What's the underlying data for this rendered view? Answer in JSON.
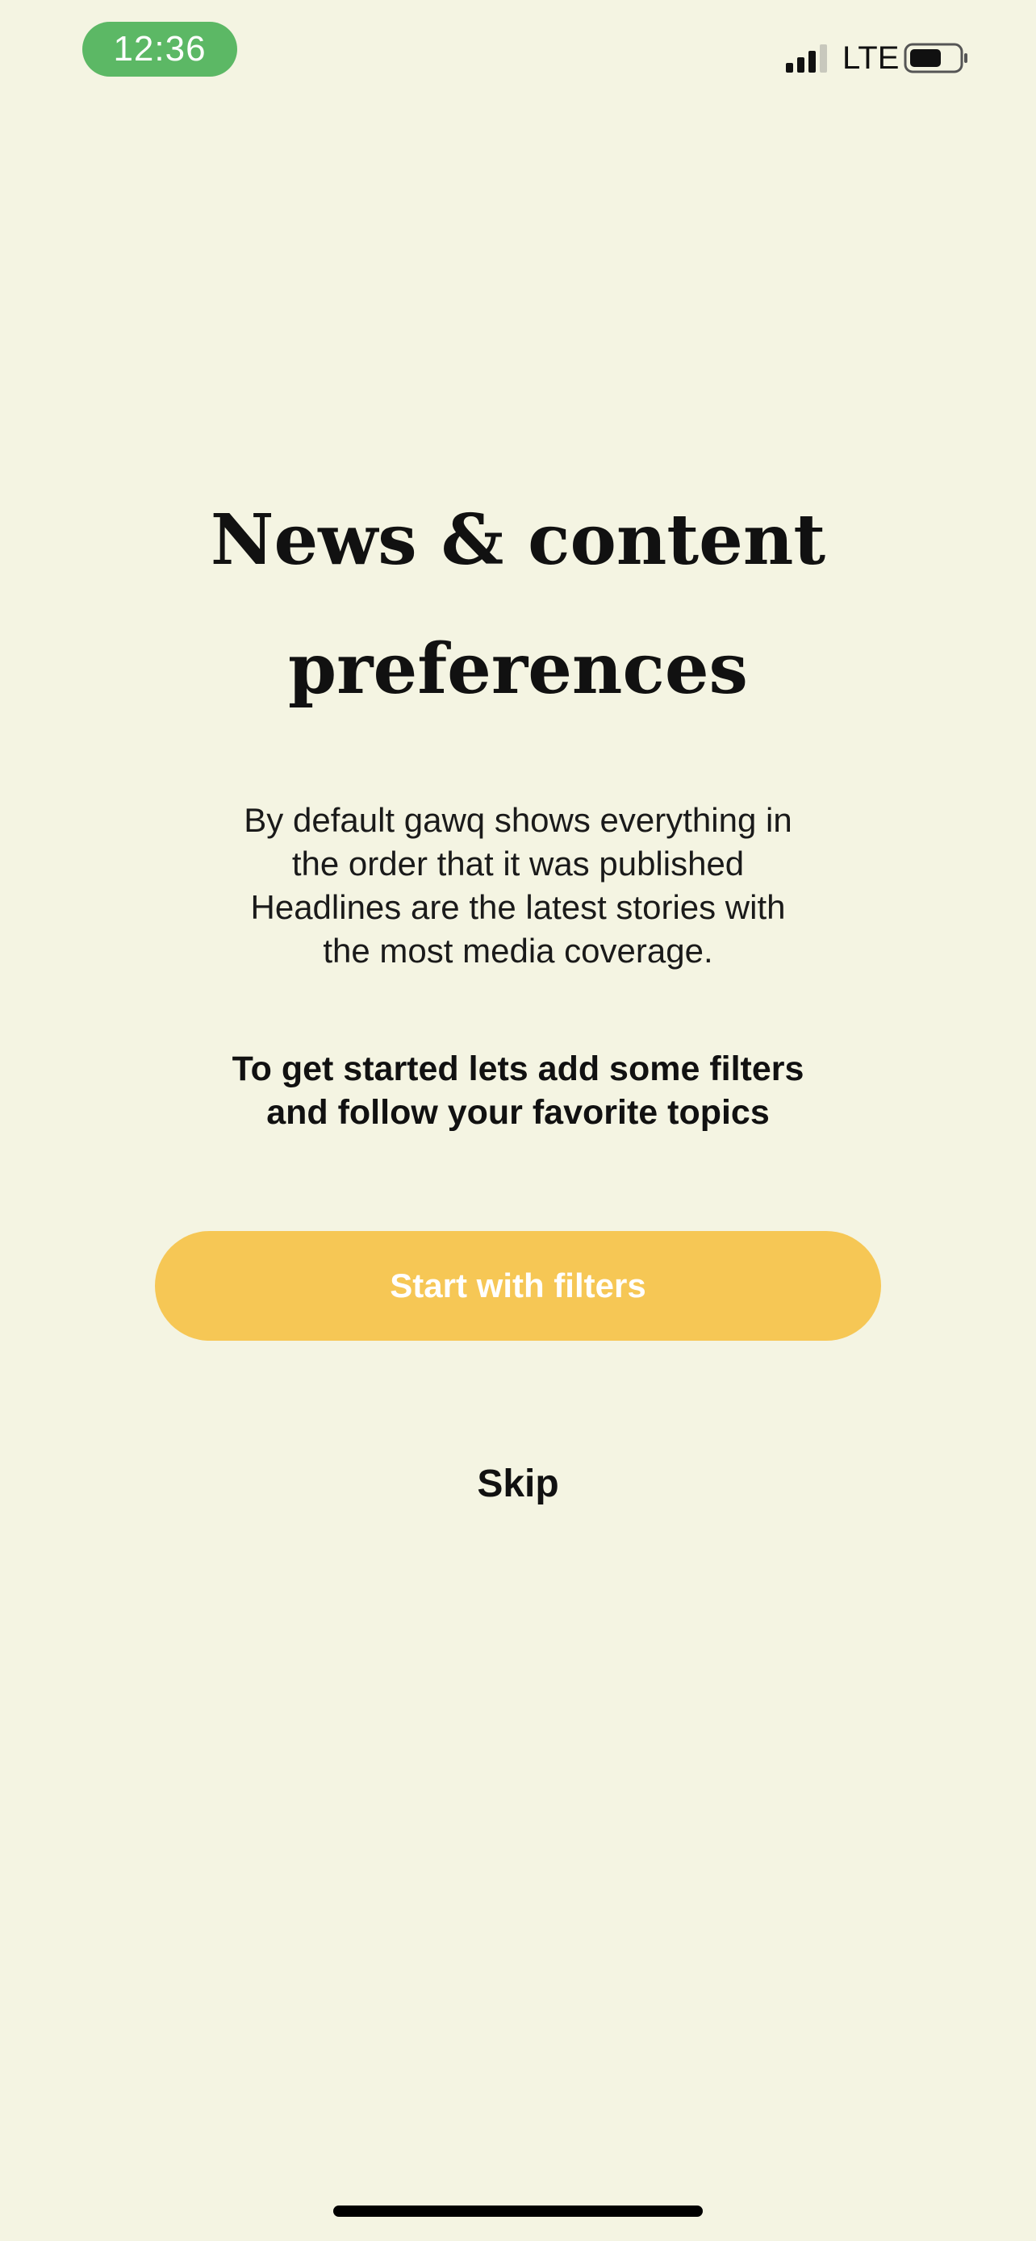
{
  "status_bar": {
    "time": "12:36",
    "network": "LTE",
    "signal_bars_active": 3,
    "signal_bars_total": 4,
    "battery_level": 0.6,
    "time_pill_color": "#5cb865"
  },
  "onboarding": {
    "title": "News & content preferences",
    "description": "By default gawq shows everything in\nthe order that it was published\nHeadlines are the latest stories with\nthe most media coverage.",
    "cta_text": "To get started lets add some filters\nand follow your favorite topics",
    "start_button_label": "Start with filters",
    "skip_label": "Skip"
  },
  "colors": {
    "background": "#f4f4e2",
    "accent_button": "#f6c755",
    "text": "#111111"
  },
  "icons": {
    "signal": "cellular-signal-icon",
    "battery": "battery-icon"
  }
}
